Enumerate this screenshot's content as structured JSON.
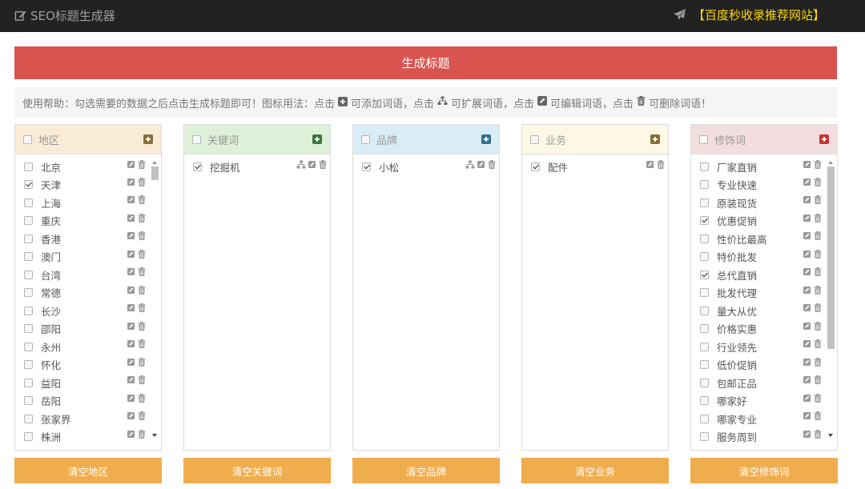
{
  "app": {
    "title": "SEO标题生成器",
    "promo": "【百度秒收录推荐网站】"
  },
  "generate_label": "生成标题",
  "help": {
    "prefix": "使用帮助：勾选需要的数据之后点击生成标题即可！图标用法：点击",
    "part2": "可添加词语，点击",
    "part3": "可扩展词语，点击",
    "part4": "可编辑词语，点击",
    "part5": "可删除词语！"
  },
  "colors": {
    "region": "#fcf8e3",
    "keyword": "#dff0d8",
    "brand": "#d9edf7",
    "business": "#fcf8e3",
    "modifier": "#f2dede"
  },
  "panels": [
    {
      "id": "region",
      "title": "地区",
      "accent": "#8a6d3b",
      "header_bg": "#f9ebd6",
      "items": [
        {
          "label": "北京",
          "checked": false
        },
        {
          "label": "天津",
          "checked": true
        },
        {
          "label": "上海",
          "checked": false
        },
        {
          "label": "重庆",
          "checked": false
        },
        {
          "label": "香港",
          "checked": false
        },
        {
          "label": "澳门",
          "checked": false
        },
        {
          "label": "台湾",
          "checked": false
        },
        {
          "label": "常德",
          "checked": false
        },
        {
          "label": "长沙",
          "checked": false
        },
        {
          "label": "邵阳",
          "checked": false
        },
        {
          "label": "永州",
          "checked": false
        },
        {
          "label": "怀化",
          "checked": false
        },
        {
          "label": "益阳",
          "checked": false
        },
        {
          "label": "岳阳",
          "checked": false
        },
        {
          "label": "张家界",
          "checked": false
        },
        {
          "label": "株洲",
          "checked": false
        }
      ],
      "expand_icon": false,
      "scroll": true,
      "clear_label": "清空地区"
    },
    {
      "id": "keyword",
      "title": "关键词",
      "accent": "#3c763d",
      "header_bg": "#dff0d8",
      "items": [
        {
          "label": "挖掘机",
          "checked": true
        }
      ],
      "expand_icon": true,
      "scroll": false,
      "clear_label": "清空关键词"
    },
    {
      "id": "brand",
      "title": "品牌",
      "accent": "#31708f",
      "header_bg": "#d9edf7",
      "items": [
        {
          "label": "小松",
          "checked": true
        }
      ],
      "expand_icon": true,
      "scroll": false,
      "clear_label": "清空品牌"
    },
    {
      "id": "business",
      "title": "业务",
      "accent": "#8a6d3b",
      "header_bg": "#fcf8e3",
      "items": [
        {
          "label": "配件",
          "checked": true
        }
      ],
      "expand_icon": false,
      "scroll": false,
      "clear_label": "清空业务"
    },
    {
      "id": "modifier",
      "title": "修饰词",
      "accent": "#c9302c",
      "header_bg": "#f2dede",
      "items": [
        {
          "label": "厂家直销",
          "checked": false
        },
        {
          "label": "专业快速",
          "checked": false
        },
        {
          "label": "原装现货",
          "checked": false
        },
        {
          "label": "优惠促销",
          "checked": true
        },
        {
          "label": "性价比最高",
          "checked": false
        },
        {
          "label": "特价批发",
          "checked": false
        },
        {
          "label": "总代直销",
          "checked": true
        },
        {
          "label": "批发代理",
          "checked": false
        },
        {
          "label": "量大从优",
          "checked": false
        },
        {
          "label": "价格实惠",
          "checked": false
        },
        {
          "label": "行业领先",
          "checked": false
        },
        {
          "label": "低价促销",
          "checked": false
        },
        {
          "label": "包邮正品",
          "checked": false
        },
        {
          "label": "哪家好",
          "checked": false
        },
        {
          "label": "哪家专业",
          "checked": false
        },
        {
          "label": "服务周到",
          "checked": false
        }
      ],
      "expand_icon": false,
      "scroll": true,
      "clear_label": "清空修饰词"
    }
  ]
}
